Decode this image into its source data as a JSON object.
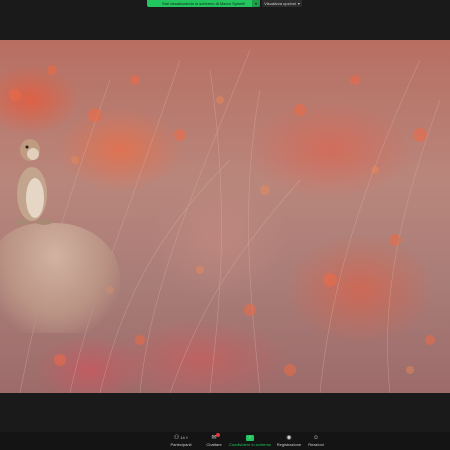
{
  "meeting": {
    "share_banner": "Stai visualizzando lo schermo di Marco Spinelli",
    "view_options_label": "Visualizza opzioni"
  },
  "toolbar": {
    "participants": {
      "label": "Partecipanti",
      "count": "14",
      "icon": "participants-icon"
    },
    "chat": {
      "label": "Chattare",
      "icon": "chat-icon",
      "has_notification": true
    },
    "share": {
      "label": "Condividere lo schermo",
      "icon": "share-screen-icon"
    },
    "record": {
      "label": "Registrazione",
      "icon": "record-icon"
    },
    "reactions": {
      "label": "Reazioni",
      "icon": "reactions-icon"
    }
  },
  "colors": {
    "accent_green": "#23c55e",
    "notification_red": "#e0373a",
    "background": "#1a1a1a"
  }
}
